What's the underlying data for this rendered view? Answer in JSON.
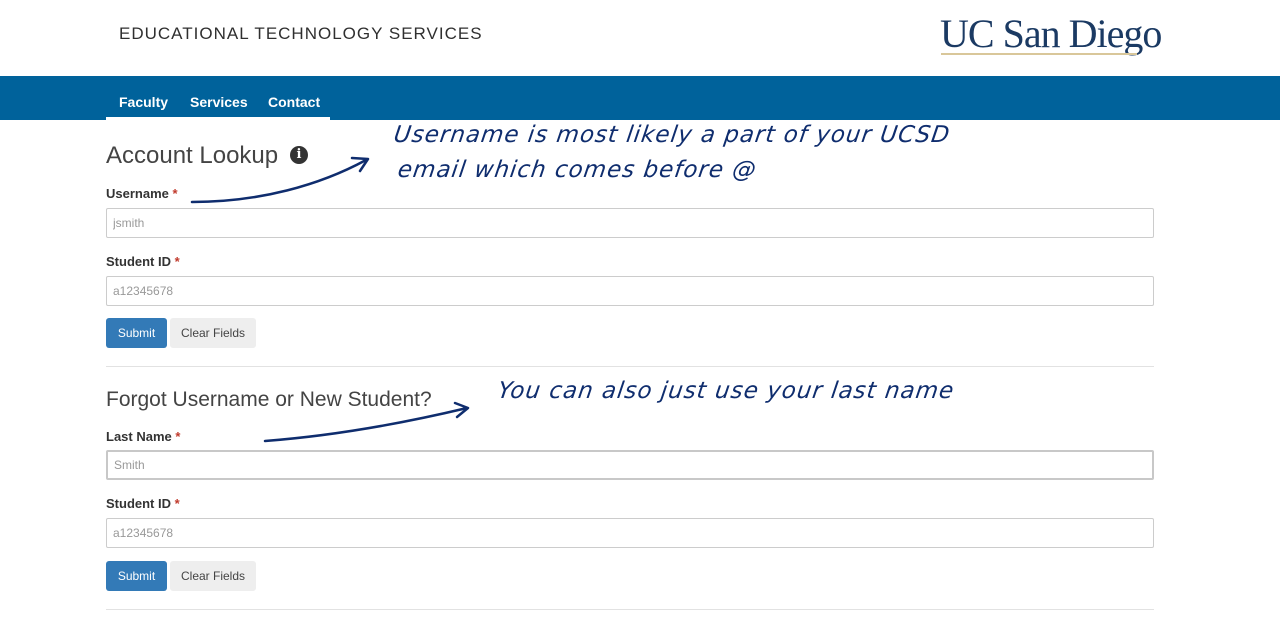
{
  "header": {
    "site_title": "EDUCATIONAL TECHNOLOGY SERVICES",
    "logo_text": "UC San Diego"
  },
  "nav": {
    "items": [
      {
        "label": "Faculty"
      },
      {
        "label": "Services"
      },
      {
        "label": "Contact"
      }
    ]
  },
  "account_lookup": {
    "title": "Account Lookup",
    "username_label": "Username",
    "username_placeholder": "jsmith",
    "student_id_label": "Student ID",
    "student_id_placeholder": "a12345678",
    "submit_label": "Submit",
    "clear_label": "Clear Fields"
  },
  "forgot": {
    "title": "Forgot Username or New Student?",
    "last_name_label": "Last Name",
    "last_name_placeholder": "Smith",
    "student_id_label": "Student ID",
    "student_id_placeholder": "a12345678",
    "submit_label": "Submit",
    "clear_label": "Clear Fields"
  },
  "required_marker": "*",
  "annotations": {
    "username_note_line1": "Username is most likely a part of your UCSD",
    "username_note_line2": "email which comes before @",
    "lastname_note": "You can also just use your last name"
  },
  "colors": {
    "nav_bar": "#00629b",
    "primary_button": "#337ab7",
    "annotation_ink": "#0f2d6e",
    "required": "#c0392b"
  }
}
